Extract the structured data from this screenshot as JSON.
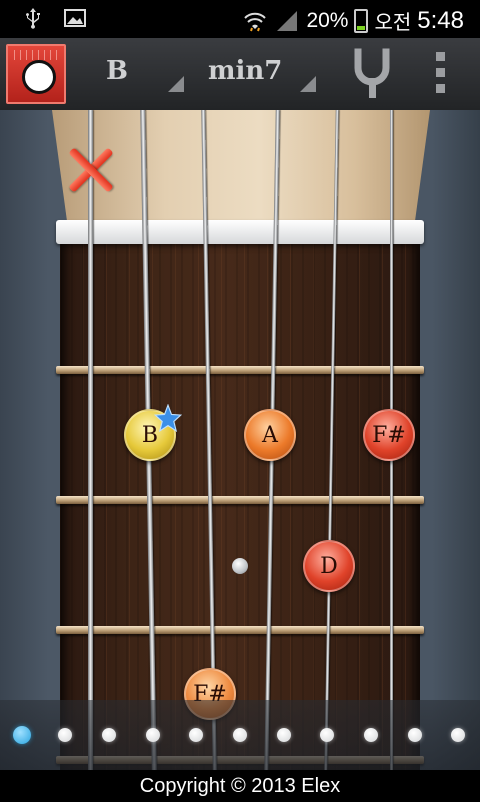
{
  "status_bar": {
    "battery_percent": "20%",
    "ampm": "오전",
    "time": "5:48"
  },
  "toolbar": {
    "key": "B",
    "chord_type": "min7"
  },
  "fretboard": {
    "notes": [
      {
        "label": "B",
        "color": "yellow",
        "root": true
      },
      {
        "label": "A",
        "color": "orange"
      },
      {
        "label": "F#",
        "color": "red"
      },
      {
        "label": "D",
        "color": "red"
      },
      {
        "label": "F#",
        "color": "tan"
      }
    ],
    "strings": 6,
    "muted_string": 1
  },
  "pager": {
    "page_count": 11,
    "active_page": 1
  },
  "footer": {
    "copyright": "Copyright © 2013 Elex"
  }
}
